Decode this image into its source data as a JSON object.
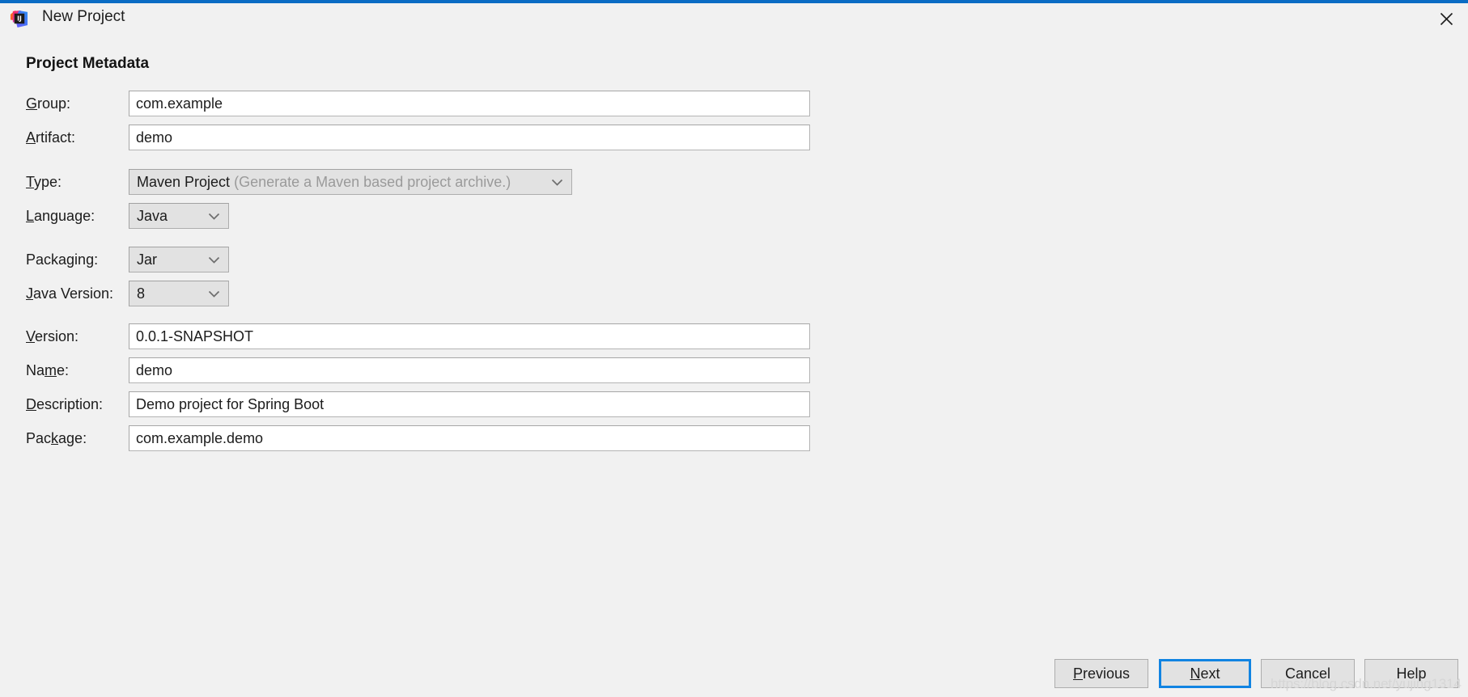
{
  "window": {
    "title": "New Project",
    "icon": "intellij-idea-logo",
    "close_icon": "close-icon",
    "accent_color": "#0a6cc4",
    "background_color": "#f1f1f1"
  },
  "section": {
    "heading": "Project Metadata"
  },
  "form": {
    "fields": [
      {
        "id": "group",
        "label": "Group:",
        "mnemonic": "G",
        "type": "text",
        "value": "com.example"
      },
      {
        "id": "artifact",
        "label": "Artifact:",
        "mnemonic": "A",
        "type": "text",
        "value": "demo"
      },
      {
        "id": "type",
        "label": "Type:",
        "mnemonic": "T",
        "type": "combo",
        "value": "Maven Project",
        "hint": "(Generate a Maven based project archive.)"
      },
      {
        "id": "language",
        "label": "Language:",
        "mnemonic": "L",
        "type": "combo",
        "value": "Java"
      },
      {
        "id": "packaging",
        "label": "Packaging:",
        "mnemonic": "g",
        "type": "combo",
        "value": "Jar"
      },
      {
        "id": "javaversion",
        "label": "Java Version:",
        "mnemonic": "J",
        "type": "combo",
        "value": "8"
      },
      {
        "id": "version",
        "label": "Version:",
        "mnemonic": "V",
        "type": "text",
        "value": "0.0.1-SNAPSHOT"
      },
      {
        "id": "name",
        "label": "Name:",
        "mnemonic": "m",
        "type": "text",
        "value": "demo"
      },
      {
        "id": "description",
        "label": "Description:",
        "mnemonic": "D",
        "type": "text",
        "value": "Demo project for Spring Boot"
      },
      {
        "id": "package",
        "label": "Package:",
        "mnemonic": "k",
        "type": "text",
        "value": "com.example.demo"
      }
    ]
  },
  "footer": {
    "buttons": [
      {
        "id": "previous",
        "label": "Previous",
        "mnemonic": "P",
        "default": false
      },
      {
        "id": "next",
        "label": "Next",
        "mnemonic": "N",
        "default": true
      },
      {
        "id": "cancel",
        "label": "Cancel",
        "mnemonic": "",
        "default": false
      },
      {
        "id": "help",
        "label": "Help",
        "mnemonic": "",
        "default": false
      }
    ],
    "focus_color": "#1184e2"
  },
  "watermark": {
    "text": "https://blog.csdn.net/yujing1314"
  }
}
